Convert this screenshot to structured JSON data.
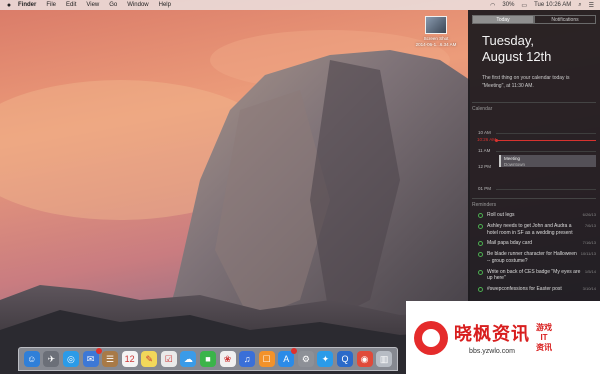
{
  "menubar": {
    "apple": "",
    "app": "Finder",
    "items": [
      "File",
      "Edit",
      "View",
      "Go",
      "Window",
      "Help"
    ],
    "battery": "30%",
    "clock": "Tue 10:26 AM"
  },
  "desktop": {
    "file_name": "Screen Shot",
    "file_date": "2014-06-1...6.34 AM"
  },
  "notification_center": {
    "tabs": [
      "Today",
      "Notifications"
    ],
    "active_tab": "Today",
    "weekday": "Tuesday,",
    "date": "August 12th",
    "summary": "The first thing on your calendar today is \"Meeting\", at 11:30 AM.",
    "calendar_label": "Calendar",
    "times": [
      "10 AM",
      "11 AM",
      "12 PM",
      "01 PM"
    ],
    "now_time": "10:26 AM",
    "event": {
      "title": "Meeting",
      "location": "Downtown"
    },
    "reminders_label": "Reminders",
    "reminders": [
      {
        "text": "Roll out legs",
        "date": "6/26/13"
      },
      {
        "text": "Ashley needs to get John and Audra a hotel room in SF as a wedding present",
        "date": "7/6/13"
      },
      {
        "text": "Mail papa bday card",
        "date": "7/16/13"
      },
      {
        "text": "Be blade runner character for Halloween -- group costume?",
        "date": "10/11/13"
      },
      {
        "text": "Write on back of CES badge \"My eyes are up here\"",
        "date": "1/5/14"
      },
      {
        "text": "#swepconfessions for Easter post",
        "date": "3/10/14"
      }
    ]
  },
  "dock": {
    "items": [
      {
        "name": "finder-icon",
        "glyph": "☺",
        "color": "#2f7fd8"
      },
      {
        "name": "launchpad-icon",
        "glyph": "✈",
        "color": "#6b6f78"
      },
      {
        "name": "safari-icon",
        "glyph": "◎",
        "color": "#2b9be8"
      },
      {
        "name": "mail-icon",
        "glyph": "✉",
        "color": "#3d78d6",
        "badge": true
      },
      {
        "name": "contacts-icon",
        "glyph": "☰",
        "color": "#a87a47"
      },
      {
        "name": "calendar-icon",
        "glyph": "12",
        "color": "#f4f4f4"
      },
      {
        "name": "notes-icon",
        "glyph": "✎",
        "color": "#f2d85a"
      },
      {
        "name": "reminders-icon",
        "glyph": "☑",
        "color": "#eaeaea"
      },
      {
        "name": "messages-icon",
        "glyph": "☁",
        "color": "#3a9be8"
      },
      {
        "name": "facetime-icon",
        "glyph": "■",
        "color": "#3bb44a"
      },
      {
        "name": "photos-icon",
        "glyph": "❀",
        "color": "#f0f0f0"
      },
      {
        "name": "itunes-icon",
        "glyph": "♫",
        "color": "#3a6fd8"
      },
      {
        "name": "ibooks-icon",
        "glyph": "☐",
        "color": "#f2922a"
      },
      {
        "name": "app-store-icon",
        "glyph": "A",
        "color": "#2b8be8",
        "badge": true
      },
      {
        "name": "system-preferences-icon",
        "glyph": "⚙",
        "color": "#8d9097"
      },
      {
        "name": "twitter-icon",
        "glyph": "✦",
        "color": "#2b9be8"
      },
      {
        "name": "quicktime-icon",
        "glyph": "Q",
        "color": "#2b6ac9"
      },
      {
        "name": "chrome-icon",
        "glyph": "◉",
        "color": "#e04a3a"
      },
      {
        "name": "trash-icon",
        "glyph": "▥",
        "color": "#b7bcc4"
      }
    ]
  },
  "watermark": {
    "title": "晓枫资讯",
    "url": "bbs.yzwlo.com",
    "side_top": "游戏",
    "side_mid": "IT",
    "side_bottom": "资讯"
  },
  "colors": {
    "accent_red": "#d8322f",
    "reminder_green": "#4caf50"
  }
}
